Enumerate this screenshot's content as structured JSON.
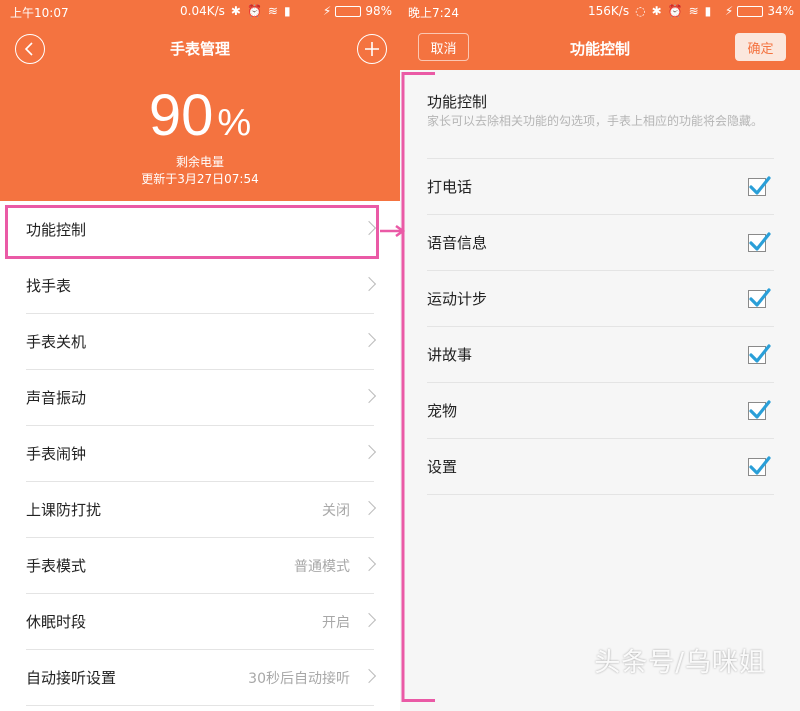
{
  "left": {
    "status": {
      "time": "上午10:07",
      "speed": "0.04K/s",
      "battery_pct": "98%",
      "battery_level": 0.98
    },
    "title": "手表管理",
    "back_icon": "chevron-left-icon",
    "add_icon": "plus-icon",
    "battery_value": "90",
    "battery_unit": "%",
    "remain_label": "剩余电量",
    "updated_text": "更新于3月27日07:54",
    "menu": [
      {
        "label": "功能控制",
        "value": ""
      },
      {
        "label": "找手表",
        "value": ""
      },
      {
        "label": "手表关机",
        "value": ""
      },
      {
        "label": "声音振动",
        "value": ""
      },
      {
        "label": "手表闹钟",
        "value": ""
      },
      {
        "label": "上课防打扰",
        "value": "关闭"
      },
      {
        "label": "手表模式",
        "value": "普通模式"
      },
      {
        "label": "休眠时段",
        "value": "开启"
      },
      {
        "label": "自动接听设置",
        "value": "30秒后自动接听"
      }
    ]
  },
  "right": {
    "status": {
      "time": "晚上7:24",
      "speed": "156K/s",
      "battery_pct": "34%",
      "battery_level": 0.34
    },
    "title": "功能控制",
    "cancel": "取消",
    "confirm": "确定",
    "section_title": "功能控制",
    "section_desc": "家长可以去除相关功能的勾选项，手表上相应的功能将会隐藏。",
    "functions": [
      {
        "label": "打电话",
        "checked": true
      },
      {
        "label": "语音信息",
        "checked": true
      },
      {
        "label": "运动计步",
        "checked": true
      },
      {
        "label": "讲故事",
        "checked": true
      },
      {
        "label": "宠物",
        "checked": true
      },
      {
        "label": "设置",
        "checked": true
      }
    ]
  },
  "watermark": "头条号/乌咪姐",
  "colors": {
    "accent": "#f47340",
    "highlight": "#ea5aa6",
    "check": "#2a9fd8"
  }
}
